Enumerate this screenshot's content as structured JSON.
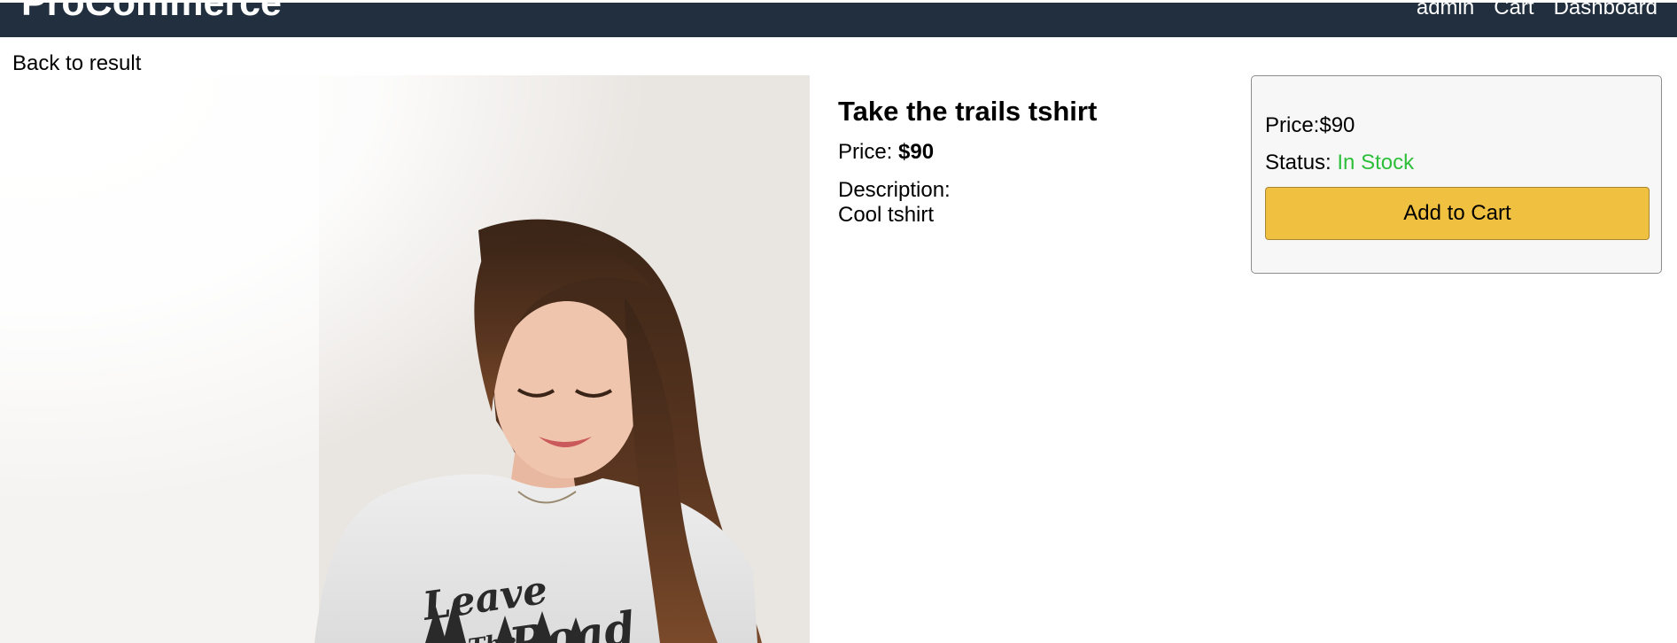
{
  "header": {
    "brand": "ProCommerce",
    "nav": [
      {
        "label": "admin"
      },
      {
        "label": "Cart"
      },
      {
        "label": "Dashboard"
      }
    ]
  },
  "back_link": "Back to result",
  "product": {
    "title": "Take the trails tshirt",
    "price_label": "Price:",
    "price_value": "$90",
    "description_label": "Description:",
    "description": "Cool tshirt",
    "image_shirt_text": [
      "Leave",
      "The",
      "Road"
    ]
  },
  "buy_box": {
    "price_label": "Price:",
    "price_value": "$90",
    "status_label": "Status:",
    "status_value": "In Stock",
    "add_to_cart_label": "Add to Cart"
  },
  "colors": {
    "navbar": "#212f3f",
    "in_stock": "#2ebf3a",
    "button": "#f0c040",
    "buy_box_bg": "#f7f7f7"
  }
}
